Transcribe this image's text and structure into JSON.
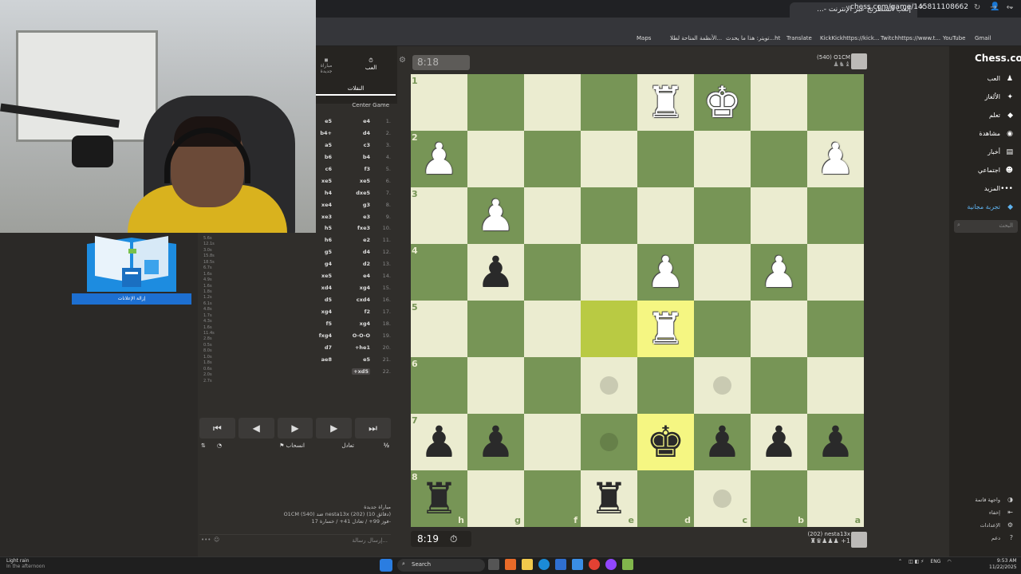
{
  "browser": {
    "tab_title": "إلعب الشطرنج عبر الإنترنت -...",
    "url": "chess.com/game/145811108662",
    "bookmarks": [
      "Maps",
      "الأنظمة المتاحة لطلا...",
      "تويتر: هذا ما يحدث...ht",
      "Translate",
      "KickKickhttps://kick...",
      "Twitchhttps://www.t...",
      "YouTube",
      "Gmail"
    ]
  },
  "overlay": {
    "badge_label": "إزالة الإعلانات"
  },
  "side_panel": {
    "tab_play": "العب",
    "tab_new_game": "مباراة جديدة",
    "tab_moves": "النقلات",
    "opening": "Center Game"
  },
  "moves": [
    {
      "n": "1.",
      "w": "e4",
      "b": "e5"
    },
    {
      "n": "2.",
      "w": "d4",
      "b": "b4+"
    },
    {
      "n": "3.",
      "w": "c3",
      "b": "a5"
    },
    {
      "n": "4.",
      "w": "b4",
      "b": "b6"
    },
    {
      "n": "5.",
      "w": "f3",
      "b": "c6"
    },
    {
      "n": "6.",
      "w": "xe5",
      "b": "xe5"
    },
    {
      "n": "7.",
      "w": "dxe5",
      "b": "h4"
    },
    {
      "n": "8.",
      "w": "g3",
      "b": "xe4"
    },
    {
      "n": "9.",
      "w": "e3",
      "b": "xe3"
    },
    {
      "n": "10.",
      "w": "fxe3",
      "b": "h5"
    },
    {
      "n": "11.",
      "w": "e2",
      "b": "h6"
    },
    {
      "n": "12.",
      "w": "d4",
      "b": "g5"
    },
    {
      "n": "13.",
      "w": "d2",
      "b": "g4"
    },
    {
      "n": "14.",
      "w": "e4",
      "b": "xe5"
    },
    {
      "n": "15.",
      "w": "xg4",
      "b": "xd4"
    },
    {
      "n": "16.",
      "w": "cxd4",
      "b": "d5"
    },
    {
      "n": "17.",
      "w": "f2",
      "b": "xg4"
    },
    {
      "n": "18.",
      "w": "xg4",
      "b": "f5"
    },
    {
      "n": "19.",
      "w": "O-O-O",
      "b": "fxg4"
    },
    {
      "n": "20.",
      "w": "+he1",
      "b": "d7"
    },
    {
      "n": "21.",
      "w": "e5",
      "b": "ae8"
    },
    {
      "n": "22.",
      "w": "+xd5",
      "b": ""
    }
  ],
  "stats": [
    "5.6s",
    "12.1s",
    "3.0s",
    "15.8s",
    "18.5s",
    "6.7s",
    "1.6s",
    "4.9s",
    "1.6s",
    "1.8s",
    "1.2s",
    "6.1s",
    "4.8s",
    "1.7s",
    "4.3s",
    "1.6s",
    "11.4s",
    "2.8s",
    "0.5s",
    "8.0s",
    "1.0s",
    "1.8s",
    "0.6s",
    "2.0s",
    "2.7s"
  ],
  "controls": {
    "first": "⏮",
    "prev": "◀",
    "play": "▶",
    "next": "▶",
    "last": "⏭"
  },
  "actions": {
    "draw": "تعادل",
    "resign": "انسحاب",
    "half": "½"
  },
  "game_info": {
    "title": "مباراة جديدة",
    "line1": "O1CM (540) ضد nesta13x (202) (10 دقائق)",
    "line2": "فوز 99+ / تعادل 41+ / خسارة 17-"
  },
  "chat_placeholder": "إرسال رسالة...",
  "players": {
    "top": {
      "name": "O1CM",
      "rating": "(540)",
      "clock": "8:18"
    },
    "bottom": {
      "name": "nesta13x",
      "rating": "(202)",
      "clock": "8:19",
      "material": "+1"
    }
  },
  "board": {
    "ranks": [
      "1",
      "2",
      "3",
      "4",
      "5",
      "6",
      "7",
      "8"
    ],
    "files": [
      "h",
      "g",
      "f",
      "e",
      "d",
      "c",
      "b",
      "a"
    ],
    "pieces": [
      {
        "sq": "d1",
        "piece": "♜",
        "color": "w"
      },
      {
        "sq": "c1",
        "piece": "♚",
        "color": "w"
      },
      {
        "sq": "h2",
        "piece": "♟",
        "color": "w"
      },
      {
        "sq": "a2",
        "piece": "♟",
        "color": "w"
      },
      {
        "sq": "g3",
        "piece": "♟",
        "color": "w"
      },
      {
        "sq": "g4",
        "piece": "♟",
        "color": "b"
      },
      {
        "sq": "d4",
        "piece": "♟",
        "color": "w"
      },
      {
        "sq": "b4",
        "piece": "♟",
        "color": "w"
      },
      {
        "sq": "d5",
        "piece": "♜",
        "color": "w"
      },
      {
        "sq": "h7",
        "piece": "♟",
        "color": "b"
      },
      {
        "sq": "g7",
        "piece": "♟",
        "color": "b"
      },
      {
        "sq": "d7",
        "piece": "♚",
        "color": "b"
      },
      {
        "sq": "c7",
        "piece": "♟",
        "color": "b"
      },
      {
        "sq": "b7",
        "piece": "♟",
        "color": "b"
      },
      {
        "sq": "a7",
        "piece": "♟",
        "color": "b"
      },
      {
        "sq": "h8",
        "piece": "♜",
        "color": "b"
      },
      {
        "sq": "e8",
        "piece": "♜",
        "color": "b"
      }
    ],
    "highlighted": [
      "e5",
      "d5",
      "d7"
    ],
    "move_dots": [
      "e6",
      "c6",
      "e7",
      "c8"
    ]
  },
  "nav": {
    "logo": "Chess.com",
    "items": [
      {
        "label": "العب",
        "icon": "play-icon"
      },
      {
        "label": "الألغاز",
        "icon": "puzzle-icon"
      },
      {
        "label": "تعلم",
        "icon": "learn-icon"
      },
      {
        "label": "مشاهدة",
        "icon": "watch-icon"
      },
      {
        "label": "أخبار",
        "icon": "news-icon"
      },
      {
        "label": "اجتماعي",
        "icon": "social-icon"
      },
      {
        "label": "المزيد",
        "icon": "more-icon"
      },
      {
        "label": "تجربة مجانية",
        "icon": "diamond-icon"
      }
    ],
    "search_placeholder": "البحث",
    "bottom": [
      "واجهة قاتمة",
      "إخفاء",
      "الإعدادات",
      "دعم"
    ]
  },
  "taskbar": {
    "weather_title": "Light rain",
    "weather_sub": "In the afternoon",
    "search": "Search",
    "lang": "ENG",
    "time": "9:53 AM",
    "date": "11/22/2025"
  },
  "colors": {
    "light_square": "#ebecd0",
    "dark_square": "#779556",
    "accent_green": "#81b64c"
  }
}
